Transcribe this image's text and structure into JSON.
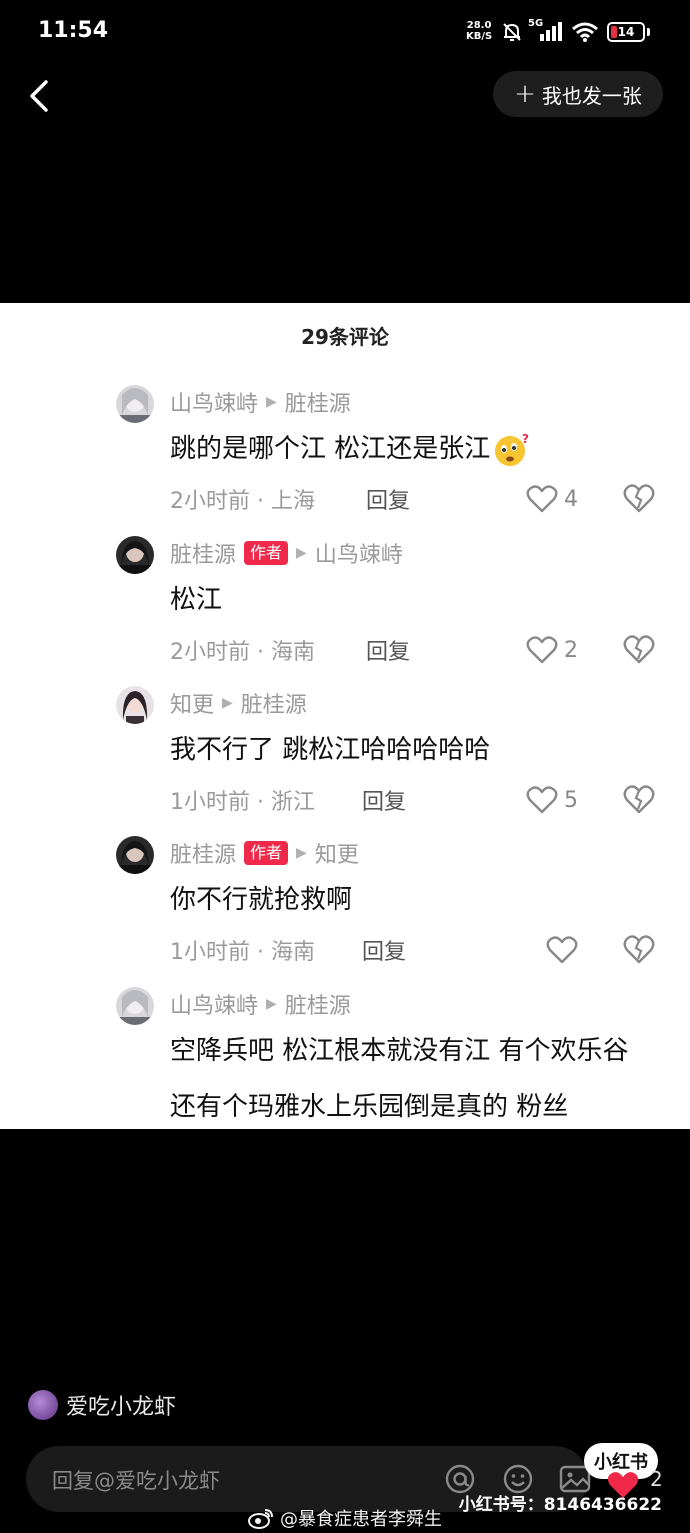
{
  "status_bar": {
    "time": "11:54",
    "net_speed_value": "28.0",
    "net_speed_unit": "KB/S",
    "signal_label": "5G",
    "battery_level": "14",
    "battery_color": "#e5303e"
  },
  "nav": {
    "back_icon": "chevron-left-icon",
    "post_button_label": "我也发一张"
  },
  "panel": {
    "comments_count_title": "29条评论",
    "author_badge_label": "作者",
    "reply_label": "回复",
    "comments": [
      {
        "user": "山鸟竦峙",
        "reply_to": "脏桂源",
        "is_author": false,
        "text": "跳的是哪个江 松江还是张江",
        "has_emoji": true,
        "time": "2小时前",
        "location": "上海",
        "likes": "4"
      },
      {
        "user": "脏桂源",
        "reply_to": "山鸟竦峙",
        "is_author": true,
        "text": "松江",
        "has_emoji": false,
        "time": "2小时前",
        "location": "海南",
        "likes": "2"
      },
      {
        "user": "知更",
        "reply_to": "脏桂源",
        "is_author": false,
        "text": "我不行了 跳松江哈哈哈哈哈",
        "has_emoji": false,
        "time": "1小时前",
        "location": "浙江",
        "likes": "5"
      },
      {
        "user": "脏桂源",
        "reply_to": "知更",
        "is_author": true,
        "text": "你不行就抢救啊",
        "has_emoji": false,
        "time": "1小时前",
        "location": "海南",
        "likes": ""
      },
      {
        "user": "山鸟竦峙",
        "reply_to": "脏桂源",
        "is_author": false,
        "text": "空降兵吧 松江根本就没有江 有个欢乐谷 还有个玛雅水上乐园倒是真的 粉丝",
        "has_emoji": false,
        "time": "",
        "location": "",
        "likes": ""
      }
    ]
  },
  "bottom": {
    "poster_name": "爱吃小龙虾",
    "reply_placeholder": "回复@爱吃小龙虾",
    "xhs_logo_text": "小红书",
    "heart_count": "2",
    "xhs_id": "小红书号：8146436622",
    "weibo_watermark": "@暴食症患者李舜生",
    "accent_red": "#f0284a"
  }
}
